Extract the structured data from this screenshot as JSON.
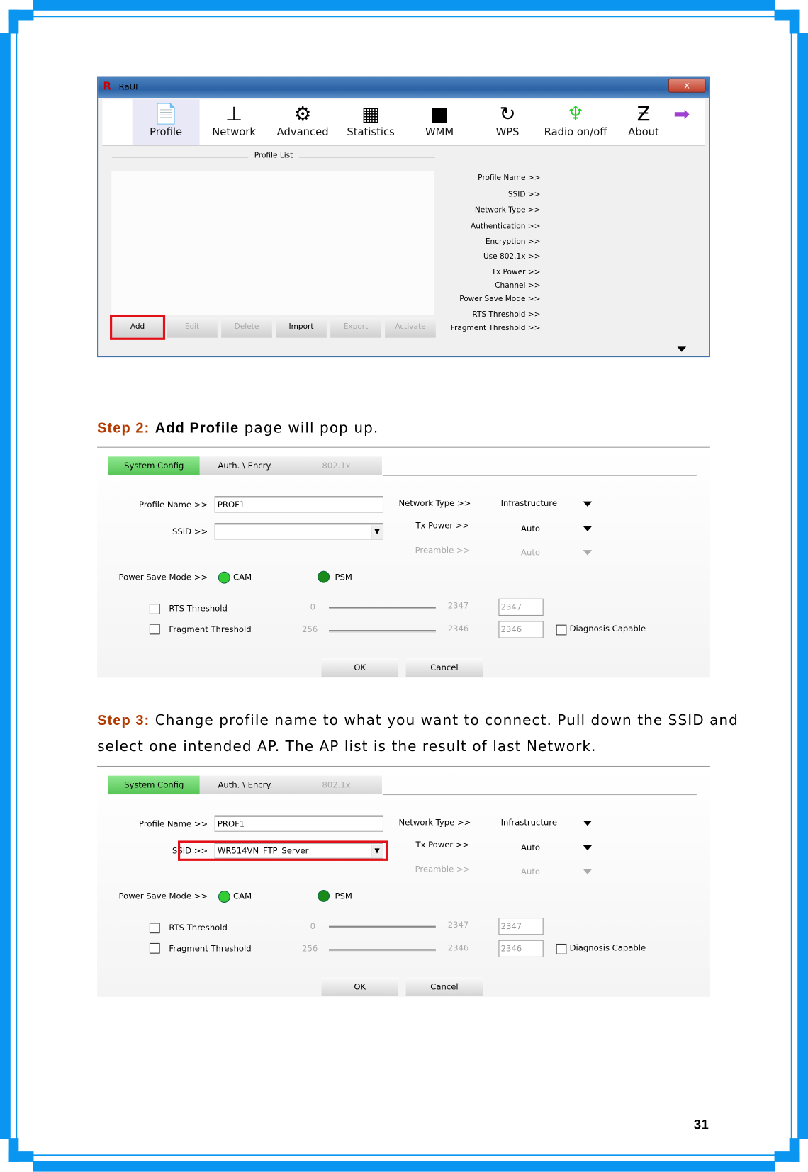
{
  "colors": {
    "frame": "#0a96f0",
    "step_key": "#b23a00",
    "highlight": "#e41018",
    "active_tab": "#6fd66f"
  },
  "window": {
    "title": "RaUI",
    "close": "x",
    "toolbar": [
      {
        "label": "Profile",
        "icon": "profile-icon"
      },
      {
        "label": "Network",
        "icon": "network-router-icon"
      },
      {
        "label": "Advanced",
        "icon": "gears-icon"
      },
      {
        "label": "Statistics",
        "icon": "calculator-icon"
      },
      {
        "label": "WMM",
        "icon": "qos-icon"
      },
      {
        "label": "WPS",
        "icon": "wps-icon"
      },
      {
        "label": "Radio on/off",
        "icon": "radio-antenna-icon"
      },
      {
        "label": "About",
        "icon": "about-logo-icon"
      }
    ],
    "profile_list_title": "Profile List",
    "buttons": {
      "add": "Add",
      "edit": "Edit",
      "delete": "Delete",
      "import": "Import",
      "export": "Export",
      "activate": "Activate"
    },
    "details": [
      "Profile Name >>",
      "SSID >>",
      "Network Type >>",
      "Authentication >>",
      "Encryption >>",
      "Use 802.1x >>",
      "Tx Power >>",
      "Channel >>",
      "Power Save Mode >>",
      "RTS Threshold >>",
      "Fragment Threshold >>"
    ]
  },
  "step2": {
    "key": "Step 2:",
    "bold": "Add Profile",
    "rest": " page will pop up."
  },
  "step3": {
    "key": "Step 3:",
    "line1": " Change profile name to what you want to connect. Pull down the SSID and",
    "line2": "select one intended AP. The AP list is the result of last Network."
  },
  "panel2": {
    "tabs": [
      "System Config",
      "Auth. \\ Encry.",
      "802.1x"
    ],
    "profile_name_label": "Profile Name >>",
    "profile_name": "PROF1",
    "ssid_label": "SSID >>",
    "ssid": "",
    "network_type_label": "Network Type >>",
    "network_type": "Infrastructure",
    "tx_power_label": "Tx Power >>",
    "tx_power": "Auto",
    "preamble_label": "Preamble >>",
    "preamble": "Auto",
    "power_save_label": "Power Save Mode >>",
    "cam": "CAM",
    "psm": "PSM",
    "rts_label": "RTS Threshold",
    "rts_min": "0",
    "rts_max": "2347",
    "rts_value": "2347",
    "frag_label": "Fragment Threshold",
    "frag_min": "256",
    "frag_max": "2346",
    "frag_value": "2346",
    "diagnosis": "Diagnosis Capable",
    "ok": "OK",
    "cancel": "Cancel"
  },
  "panel3": {
    "tabs": [
      "System Config",
      "Auth. \\ Encry.",
      "802.1x"
    ],
    "profile_name_label": "Profile Name >>",
    "profile_name": "PROF1",
    "ssid_label": "SSID >>",
    "ssid": "WR514VN_FTP_Server",
    "network_type_label": "Network Type >>",
    "network_type": "Infrastructure",
    "tx_power_label": "Tx Power >>",
    "tx_power": "Auto",
    "preamble_label": "Preamble >>",
    "preamble": "Auto",
    "power_save_label": "Power Save Mode >>",
    "cam": "CAM",
    "psm": "PSM",
    "rts_label": "RTS Threshold",
    "rts_min": "0",
    "rts_max": "2347",
    "rts_value": "2347",
    "frag_label": "Fragment Threshold",
    "frag_min": "256",
    "frag_max": "2346",
    "frag_value": "2346",
    "diagnosis": "Diagnosis Capable",
    "ok": "OK",
    "cancel": "Cancel"
  },
  "page_number": "31"
}
